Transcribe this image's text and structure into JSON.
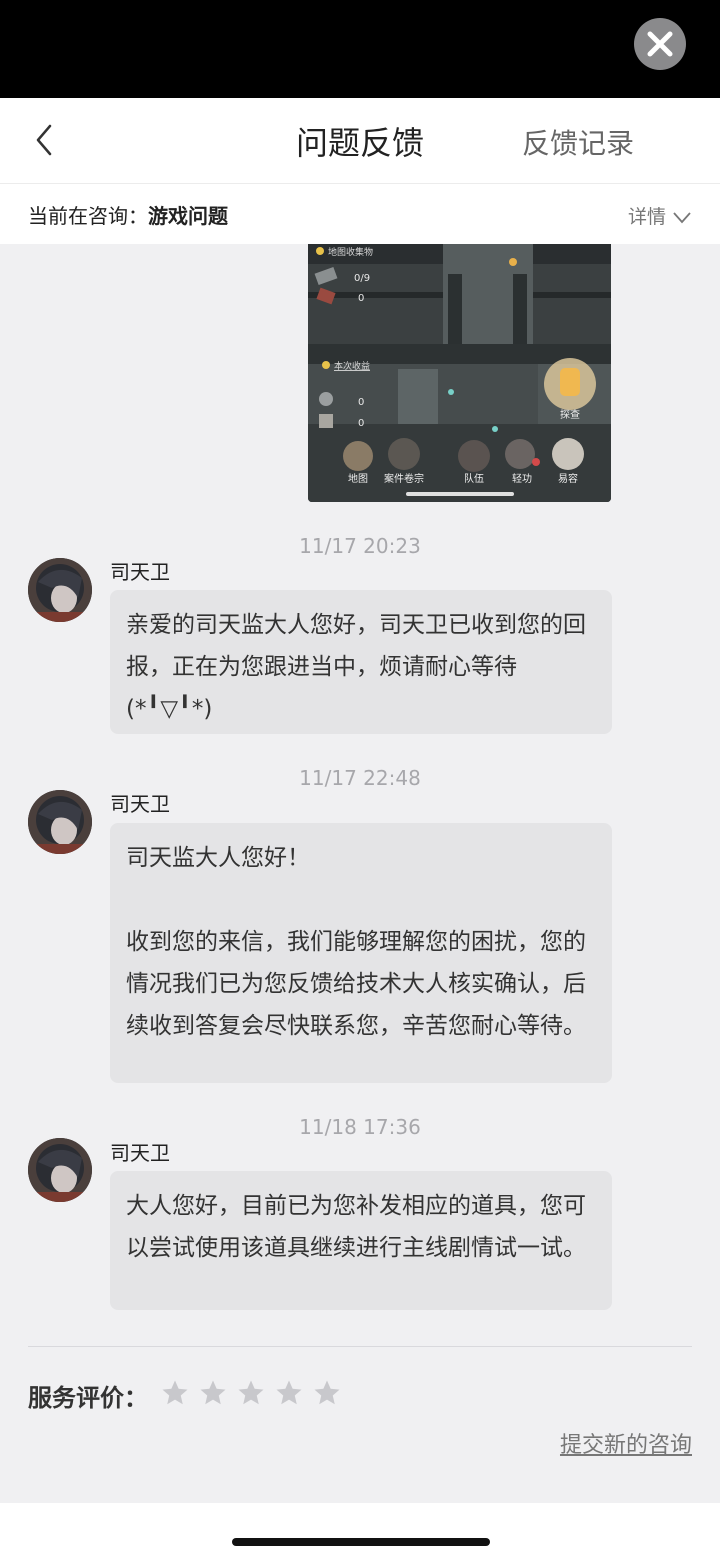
{
  "header": {
    "title": "问题反馈",
    "right_link": "反馈记录"
  },
  "consult": {
    "prefix": "当前在咨询：",
    "topic": "游戏问题",
    "detail": "详情"
  },
  "screenshot": {
    "collect_title": "地图收集物",
    "count_a": "0/9",
    "count_b": "0",
    "income_title": "本次收益",
    "count_c": "0",
    "count_d": "0",
    "investigate": "探查",
    "bottom_labels": [
      "地图",
      "案件卷宗",
      "队伍",
      "轻功",
      "易容"
    ]
  },
  "messages": [
    {
      "time": "11/17 20:23",
      "sender": "司天卫",
      "paragraphs": [
        "亲爱的司天监大人您好，司天卫已收到您的回报，正在为您跟进当中，烦请耐心等待(*╹▽╹*)"
      ]
    },
    {
      "time": "11/17 22:48",
      "sender": "司天卫",
      "paragraphs": [
        "司天监大人您好！",
        "收到您的来信，我们能够理解您的困扰，您的情况我们已为您反馈给技术大人核实确认，后续收到答复会尽快联系您，辛苦您耐心等待。"
      ]
    },
    {
      "time": "11/18 17:36",
      "sender": "司天卫",
      "paragraphs": [
        "大人您好，目前已为您补发相应的道具，您可以尝试使用该道具继续进行主线剧情试一试。"
      ]
    }
  ],
  "rating": {
    "label": "服务评价：",
    "stars": 5,
    "selected": 0
  },
  "footer": {
    "new_consult": "提交新的咨询"
  },
  "colors": {
    "background": "#f0f0f2",
    "bubble": "#e4e4e6",
    "star_empty": "#c8c8cc"
  }
}
